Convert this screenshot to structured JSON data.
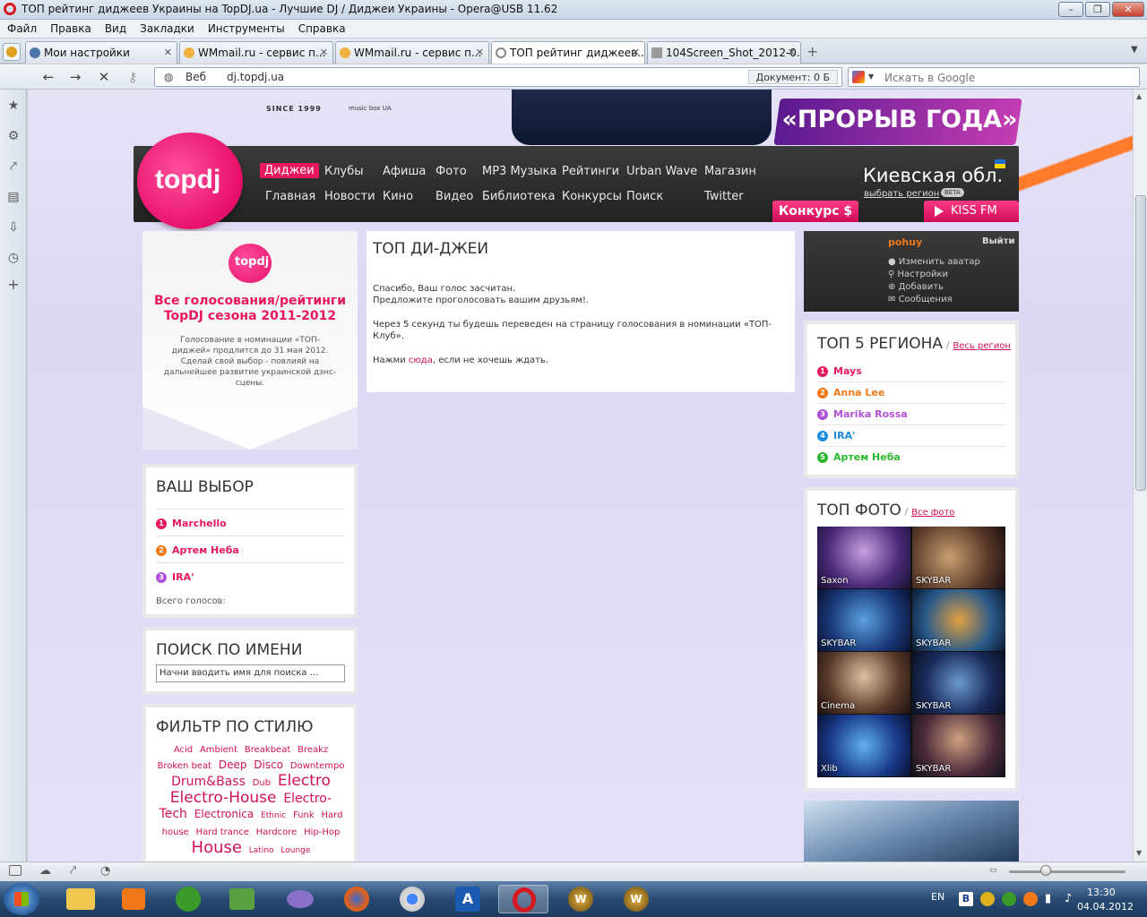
{
  "window": {
    "title": "ТОП рейтинг диджеев Украины на TopDJ.ua - Лучшие DJ / Диджеи Украины - Opera@USB 11.62"
  },
  "menu": [
    "Файл",
    "Правка",
    "Вид",
    "Закладки",
    "Инструменты",
    "Справка"
  ],
  "tabs": [
    {
      "label": "Мои настройки",
      "icon_color": "#4a76a8",
      "active": false
    },
    {
      "label": "WMmail.ru - сервис п...",
      "icon_color": "#f0b040",
      "active": false
    },
    {
      "label": "WMmail.ru - сервис п...",
      "icon_color": "#f0b040",
      "active": false
    },
    {
      "label": "ТОП рейтинг диджеев...",
      "icon_color": "#888888",
      "active": true
    },
    {
      "label": "104Screen_Shot_2012-0...",
      "icon_color": "#999999",
      "active": false
    }
  ],
  "address": {
    "web_label": "Веб",
    "url": "dj.topdj.ua",
    "document": "Документ:  0 Б",
    "search_placeholder": "Искать в Google"
  },
  "site": {
    "logo": "topdj",
    "since": "SINCE 1999",
    "musicbox": "music box UA",
    "promo": "«ПРОРЫВ ГОДА»",
    "nav_row1": [
      "Диджеи",
      "Клубы",
      "Афиша",
      "Фото",
      "MP3 Музыка",
      "Рейтинги",
      "Urban Wave",
      "Магазин"
    ],
    "nav_row2": [
      "Главная",
      "Новости",
      "Кино",
      "Видео",
      "Библиотека",
      "Конкурсы",
      "Поиск",
      "Twitter"
    ],
    "region": "Киевская обл.",
    "region_link": "выбрать регион",
    "beta": "BETA",
    "konkurs": "Конкурс $",
    "kissfm": "KISS FM"
  },
  "left": {
    "promo_logo": "topdj",
    "promo_title": "Все голосования/рейтинги TopDJ сезона 2011-2012",
    "promo_text": "Голосование в номинации «ТОП-диджей» продлится до 31 мая 2012. Сделай свой выбор - повлияй на дальнейшее развитие украинской дэнс-сцены.",
    "choice_title": "ВАШ ВЫБОР",
    "choices": [
      {
        "num": "1",
        "name": "Marchello",
        "color": "#e8185f"
      },
      {
        "num": "2",
        "name": "Артем Неба",
        "color": "#f07818"
      },
      {
        "num": "3",
        "name": "IRA'",
        "color": "#b050d8"
      }
    ],
    "total_votes": "Всего голосов:",
    "search_title": "ПОИСК ПО ИМЕНИ",
    "search_placeholder": "Начни вводить имя для поиска ...",
    "filter_title": "ФИЛЬТР ПО СТИЛЮ",
    "tags": [
      {
        "t": "Acid",
        "s": 10
      },
      {
        "t": "Ambient",
        "s": 10
      },
      {
        "t": "Breakbeat",
        "s": 10
      },
      {
        "t": "Breakz",
        "s": 10
      },
      {
        "t": "Broken beat",
        "s": 10
      },
      {
        "t": "Deep",
        "s": 12
      },
      {
        "t": "Disco",
        "s": 12
      },
      {
        "t": "Downtempo",
        "s": 10
      },
      {
        "t": "Drum&Bass",
        "s": 14
      },
      {
        "t": "Dub",
        "s": 10
      },
      {
        "t": "Electro",
        "s": 17
      },
      {
        "t": "Electro-House",
        "s": 17
      },
      {
        "t": "Electro-",
        "s": 14
      },
      {
        "t": "Tech",
        "s": 14
      },
      {
        "t": "Electronica",
        "s": 12
      },
      {
        "t": "Ethnic",
        "s": 9
      },
      {
        "t": "Funk",
        "s": 10
      },
      {
        "t": "Hard",
        "s": 10
      },
      {
        "t": "house",
        "s": 10
      },
      {
        "t": "Hard trance",
        "s": 10
      },
      {
        "t": "Hardcore",
        "s": 10
      },
      {
        "t": "Hip-Hop",
        "s": 10
      },
      {
        "t": "House",
        "s": 18
      },
      {
        "t": "Latino",
        "s": 9
      },
      {
        "t": "Lounge",
        "s": 9
      }
    ]
  },
  "center": {
    "title": "ТОП ДИ-ДЖЕИ",
    "line1": "Спасибо, Ваш голос засчитан.",
    "line2": "Предложите проголосовать вашим друзьям!.",
    "line3": "Через 5 секунд ты будешь переведен на страницу голосования в номинации «ТОП-Клуб».",
    "line4_pre": "Нажми ",
    "line4_link": "сюда",
    "line4_post": ", если не хочешь ждать."
  },
  "right": {
    "user": "pohuy",
    "logout": "Выйти",
    "user_links": [
      "Изменить аватар",
      "Настройки",
      "Добавить",
      "Сообщения"
    ],
    "top5_title": "ТОП 5 РЕГИОНА",
    "top5_link": "Весь регион",
    "top5": [
      {
        "num": "1",
        "name": "Mays",
        "color": "#e8185f"
      },
      {
        "num": "2",
        "name": "Anna Lee",
        "color": "#f07818"
      },
      {
        "num": "3",
        "name": "Marika Rossa",
        "color": "#b050d8"
      },
      {
        "num": "4",
        "name": "IRA'",
        "color": "#1c8ee0"
      },
      {
        "num": "5",
        "name": "Артем Неба",
        "color": "#2cb82c"
      }
    ],
    "photo_title": "ТОП ФОТО",
    "photo_link": "Все фото",
    "photos": [
      "Saxon",
      "SKYBAR",
      "SKYBAR",
      "SKYBAR",
      "Cinema",
      "SKYBAR",
      "Xlib",
      "SKYBAR"
    ]
  },
  "taskbar": {
    "lang": "EN",
    "time": "13:30",
    "date": "04.04.2012"
  }
}
